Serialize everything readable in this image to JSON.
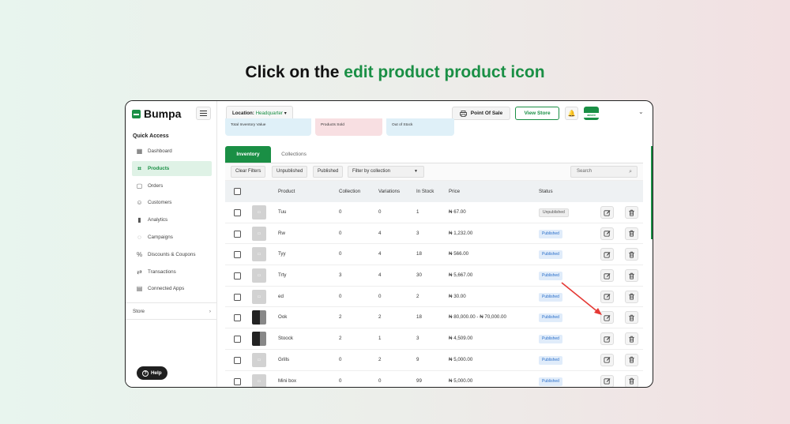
{
  "headline": {
    "prefix": "Click on the ",
    "highlight": "edit product product icon"
  },
  "brand": {
    "name": "Bumpa",
    "accent": "#1a8f45"
  },
  "sidebar": {
    "section": "Quick Access",
    "items": [
      {
        "label": "Dashboard",
        "icon": "grid-icon",
        "active": false
      },
      {
        "label": "Products",
        "icon": "tag-icon",
        "active": true
      },
      {
        "label": "Orders",
        "icon": "box-icon",
        "active": false
      },
      {
        "label": "Customers",
        "icon": "users-icon",
        "active": false
      },
      {
        "label": "Analytics",
        "icon": "bar-chart-icon",
        "active": false
      },
      {
        "label": "Campaigns",
        "icon": "chat-icon",
        "active": false
      },
      {
        "label": "Discounts & Coupons",
        "icon": "percent-icon",
        "active": false
      },
      {
        "label": "Transactions",
        "icon": "swap-icon",
        "active": false
      },
      {
        "label": "Connected Apps",
        "icon": "apps-icon",
        "active": false
      }
    ],
    "store": "Store",
    "help": "Help"
  },
  "topbar": {
    "location_label": "Location:",
    "location_value": "Headquarter",
    "pos": "Point Of Sale",
    "view_store": "View Store",
    "avatar_text": "ament"
  },
  "stats": [
    "Total Inventory Value",
    "Products Sold",
    "Out of Stock"
  ],
  "tabs": [
    "Inventory",
    "Collections"
  ],
  "filters": {
    "clear": "Clear Filters",
    "unpublished": "Unpublished",
    "published": "Published",
    "collection": "Filter by collection",
    "search_placeholder": "Search"
  },
  "table": {
    "columns": [
      "Product",
      "Collection",
      "Variations",
      "In Stock",
      "Price",
      "Status"
    ],
    "rows": [
      {
        "name": "Tuu",
        "collection": "0",
        "variations": "0",
        "stock": "1",
        "price": "₦ 67.00",
        "status": "Unpublished",
        "thumb": "placeholder"
      },
      {
        "name": "Rw",
        "collection": "0",
        "variations": "4",
        "stock": "3",
        "price": "₦ 1,232.00",
        "status": "Published",
        "thumb": "placeholder"
      },
      {
        "name": "Tyy",
        "collection": "0",
        "variations": "4",
        "stock": "18",
        "price": "₦ 566.00",
        "status": "Published",
        "thumb": "placeholder"
      },
      {
        "name": "Trty",
        "collection": "3",
        "variations": "4",
        "stock": "30",
        "price": "₦ 5,667.00",
        "status": "Published",
        "thumb": "placeholder"
      },
      {
        "name": "ed",
        "collection": "0",
        "variations": "0",
        "stock": "2",
        "price": "₦ 30.00",
        "status": "Published",
        "thumb": "placeholder"
      },
      {
        "name": "Ook",
        "collection": "2",
        "variations": "2",
        "stock": "18",
        "price": "₦ 80,000.00 - ₦ 70,000.00",
        "status": "Published",
        "thumb": "photo"
      },
      {
        "name": "Stoock",
        "collection": "2",
        "variations": "1",
        "stock": "3",
        "price": "₦ 4,509.00",
        "status": "Published",
        "thumb": "photo"
      },
      {
        "name": "Grills",
        "collection": "0",
        "variations": "2",
        "stock": "9",
        "price": "₦ 5,000.00",
        "status": "Published",
        "thumb": "placeholder"
      },
      {
        "name": "Mini box",
        "collection": "0",
        "variations": "0",
        "stock": "99",
        "price": "₦ 5,000.00",
        "status": "Published",
        "thumb": "placeholder"
      }
    ]
  },
  "annotation": {
    "color": "#e53935",
    "target_row": 5
  }
}
